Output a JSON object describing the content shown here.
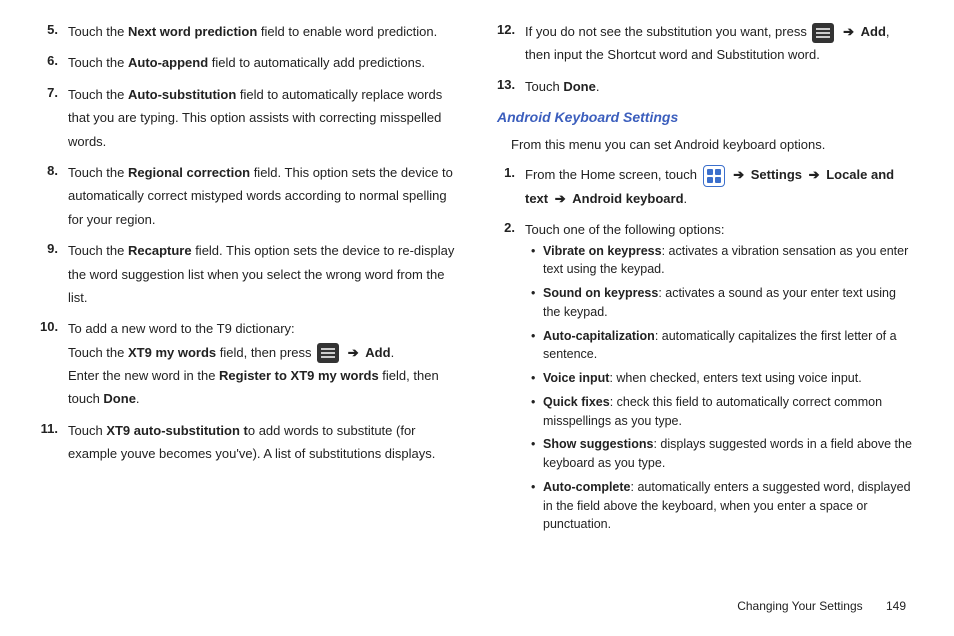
{
  "left": {
    "steps": [
      {
        "num": "5.",
        "pre": "Touch the ",
        "bold1": "Next word prediction",
        "post1": " field to enable word prediction."
      },
      {
        "num": "6.",
        "pre": "Touch the ",
        "bold1": "Auto-append",
        "post1": " field to automatically add predictions."
      },
      {
        "num": "7.",
        "pre": "Touch the ",
        "bold1": "Auto-substitution",
        "post1": " field to automatically replace words that you are typing. This option assists with correcting misspelled words."
      },
      {
        "num": "8.",
        "pre": "Touch the ",
        "bold1": "Regional correction",
        "post1": " field. This option sets the device to automatically correct mistyped words according to normal spelling for your region."
      },
      {
        "num": "9.",
        "pre": "Touch the ",
        "bold1": "Recapture",
        "post1": " field. This option sets the device to re-display the word suggestion list when you select the wrong word from the list."
      }
    ],
    "step10_num": "10.",
    "step10_line1": "To add a new word to the T9 dictionary:",
    "step10_line2_pre": "Touch the ",
    "step10_line2_bold": "XT9 my words",
    "step10_line2_mid": " field, then press ",
    "step10_line2_add": "Add",
    "step10_line2_dot": ".",
    "step10_line3_pre": "Enter the new word in the ",
    "step10_line3_bold": "Register to XT9 my words",
    "step10_line3_mid": " field, then touch ",
    "step10_line3_bold2": "Done",
    "step10_line3_end": ".",
    "step11_num": "11.",
    "step11_pre": "Touch ",
    "step11_bold": "XT9 auto-substitution t",
    "step11_post": "o add words to substitute (for example youve becomes you've). A list of substitutions displays."
  },
  "right": {
    "step12_num": "12.",
    "step12_pre": "If you do not see the substitution you want, press ",
    "step12_add": "Add",
    "step12_post": ", then input the Shortcut word and Substitution word.",
    "step13_num": "13.",
    "step13_pre": "Touch ",
    "step13_bold": "Done",
    "step13_end": ".",
    "heading": "Android Keyboard Settings",
    "intro": "From this menu you can set Android keyboard options.",
    "r1_num": "1.",
    "r1_pre": "From the Home screen, touch ",
    "r1_settings": "Settings",
    "r1_locale": "Locale and text",
    "r1_android": "Android keyboard",
    "r1_dot": ".",
    "r2_num": "2.",
    "r2_text": "Touch one of the following options:",
    "bullets": [
      {
        "bold": "Vibrate on keypress",
        "rest": ": activates a vibration sensation as you enter text using the keypad."
      },
      {
        "bold": "Sound on keypress",
        "rest": ": activates a sound as your enter text using the keypad."
      },
      {
        "bold": "Auto-capitalization",
        "rest": ": automatically capitalizes the first letter of a sentence."
      },
      {
        "bold": "Voice input",
        "rest": ": when checked, enters text using voice input."
      },
      {
        "bold": "Quick fixes",
        "rest": ": check this field to automatically correct common misspellings as you type."
      },
      {
        "bold": "Show suggestions",
        "rest": ": displays suggested words in a field above the keyboard as you type."
      },
      {
        "bold": "Auto-complete",
        "rest": ": automatically enters a suggested word, displayed in the field above the keyboard, when you enter a space or punctuation."
      }
    ]
  },
  "footer": {
    "section": "Changing Your Settings",
    "page": "149"
  },
  "arrow": "➔"
}
